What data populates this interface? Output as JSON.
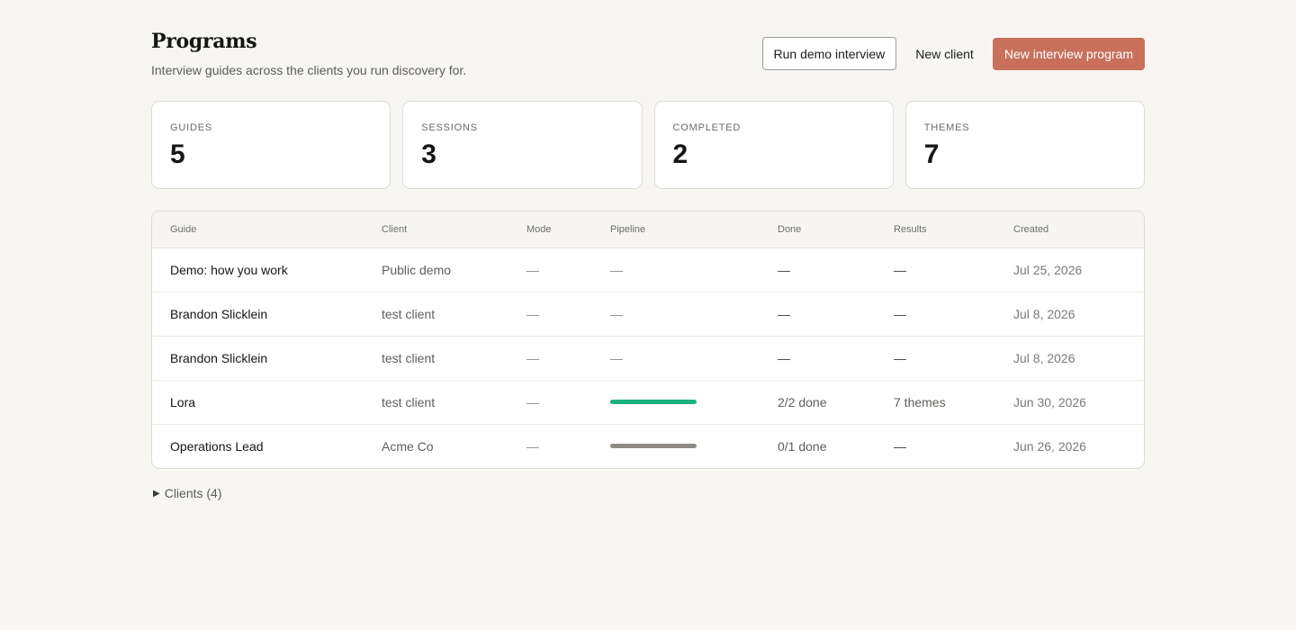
{
  "header": {
    "title": "Programs",
    "subtitle": "Interview guides across the clients you run discovery for.",
    "actions": {
      "run_demo": "Run demo interview",
      "new_client": "New client",
      "new_program": "New interview program"
    }
  },
  "stats": [
    {
      "label": "Guides",
      "value": "5"
    },
    {
      "label": "Sessions",
      "value": "3"
    },
    {
      "label": "Completed",
      "value": "2"
    },
    {
      "label": "Themes",
      "value": "7"
    }
  ],
  "table": {
    "columns": [
      "Guide",
      "Client",
      "Mode",
      "Pipeline",
      "Done",
      "Results",
      "Created"
    ],
    "rows": [
      {
        "guide": "Demo: how you work",
        "client": "Public demo",
        "mode": "—",
        "pipeline": "—",
        "done": "—",
        "results": "—",
        "created": "Jul 25, 2026"
      },
      {
        "guide": "Brandon Slicklein",
        "client": "test client",
        "mode": "—",
        "pipeline": "—",
        "done": "—",
        "results": "—",
        "created": "Jul 8, 2026"
      },
      {
        "guide": "Brandon Slicklein",
        "client": "test client",
        "mode": "—",
        "pipeline": "—",
        "done": "—",
        "results": "—",
        "created": "Jul 8, 2026"
      },
      {
        "guide": "Lora",
        "client": "test client",
        "mode": "—",
        "pipeline_progress": 1.0,
        "pipeline_color": "#1ab07f",
        "done": "2/2 done",
        "results": "7 themes",
        "created": "Jun 30, 2026"
      },
      {
        "guide": "Operations Lead",
        "client": "Acme Co",
        "mode": "—",
        "pipeline_progress": 0.0,
        "pipeline_color": "#8e8b86",
        "done": "0/1 done",
        "results": "—",
        "created": "Jun 26, 2026"
      }
    ]
  },
  "clients_toggle": {
    "label": "Clients (4)",
    "icon": "triangle-right-icon"
  },
  "colors": {
    "accent": "#c8705a",
    "success": "#1ab07f",
    "neutral_bar": "#8e8b86"
  }
}
